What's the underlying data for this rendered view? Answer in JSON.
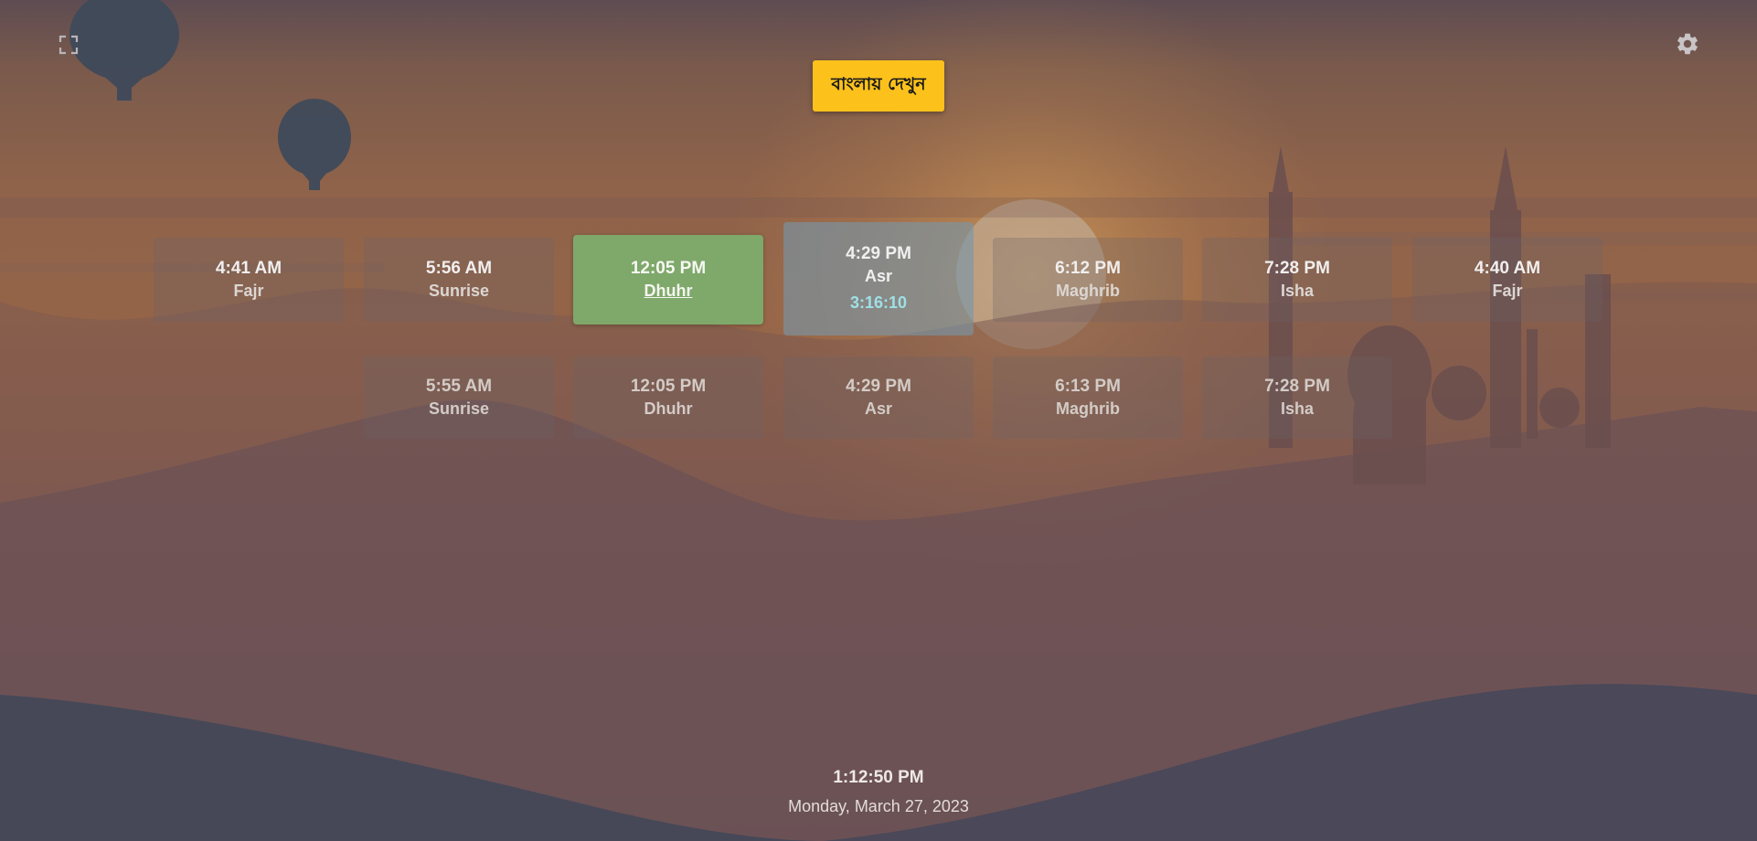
{
  "toolbar": {
    "fullscreen_icon": "fullscreen-icon",
    "settings_icon": "gear-icon",
    "language_button_label": "বাংলায় দেখুন"
  },
  "today": [
    {
      "time": "4:41 AM",
      "name": "Fajr"
    },
    {
      "time": "5:56 AM",
      "name": "Sunrise"
    },
    {
      "time": "12:05 PM",
      "name": "Dhuhr"
    },
    {
      "time": "4:29 PM",
      "name": "Asr",
      "countdown": "3:16:10"
    },
    {
      "time": "6:12 PM",
      "name": "Maghrib"
    },
    {
      "time": "7:28 PM",
      "name": "Isha"
    },
    {
      "time": "4:40 AM",
      "name": "Fajr"
    }
  ],
  "tomorrow": [
    {
      "time": "5:55 AM",
      "name": "Sunrise"
    },
    {
      "time": "12:05 PM",
      "name": "Dhuhr"
    },
    {
      "time": "4:29 PM",
      "name": "Asr"
    },
    {
      "time": "6:13 PM",
      "name": "Maghrib"
    },
    {
      "time": "7:28 PM",
      "name": "Isha"
    }
  ],
  "clock": {
    "time": "1:12:50 PM",
    "date": "Monday, March 27, 2023"
  },
  "colors": {
    "language_button": "#fcc21b",
    "current_prayer": "#7fa86b",
    "next_prayer": "#7896aa",
    "countdown": "#9fe0e6"
  }
}
